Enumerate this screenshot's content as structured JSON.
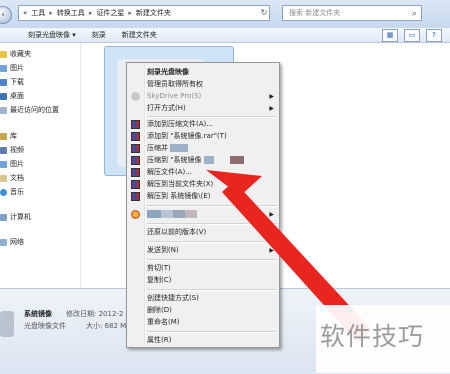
{
  "address_bar": {
    "back_icon": "back-arrow-icon",
    "forward_icon": "forward-arrow-icon",
    "path": [
      "«",
      "工具",
      "转换工具",
      "证件之星",
      "新建文件夹"
    ],
    "refresh_icon": "refresh-icon",
    "search_placeholder": "搜索 新建文件夹",
    "search_icon": "magnifier-icon"
  },
  "toolbar": {
    "items": [
      "刻录光盘映像 ▾",
      "刻录",
      "新建文件夹"
    ]
  },
  "sidebar": {
    "favorites_header": "收藏夹",
    "favorites": [
      "图片",
      "下载",
      "桌面",
      "最近访问的位置"
    ],
    "library_header": "库",
    "libraries": [
      "视频",
      "图片",
      "文档",
      "音乐"
    ],
    "computer": "计算机",
    "network": "网络"
  },
  "details": {
    "file_name": "系统镜像",
    "file_type": "光盘映像文件",
    "modified_label": "修改日期: 2012-2",
    "size_label": "大小: 682 MB"
  },
  "context_menu": {
    "items": [
      {
        "label": "刻录光盘映像",
        "bold": true
      },
      {
        "label": "管理员取得所有权"
      },
      {
        "label": "SkyDrive Pro(S)",
        "disabled": true,
        "submenu": true
      },
      {
        "label": "打开方式(H)",
        "submenu": true
      },
      {
        "label": "添加到压缩文件(A)...",
        "icon": "winrar-icon"
      },
      {
        "label": "添加到 \"系统镜像.rar\"(T)",
        "icon": "winrar-icon"
      },
      {
        "label": "压缩并",
        "icon": "winrar-icon"
      },
      {
        "label": "压缩到 \"系统镜像",
        "icon": "winrar-icon"
      },
      {
        "label": "解压文件(A)...",
        "icon": "winrar-icon"
      },
      {
        "label": "解压到当前文件夹(X)",
        "icon": "winrar-icon"
      },
      {
        "label": "解压到 系统镜像\\(E)",
        "icon": "winrar-icon"
      },
      {
        "label": "",
        "icon": "app-icon",
        "submenu": true
      },
      {
        "label": "还原以前的版本(V)"
      },
      {
        "label": "发送到(N)",
        "submenu": true
      },
      {
        "label": "剪切(T)"
      },
      {
        "label": "复制(C)"
      },
      {
        "label": "创建快捷方式(S)"
      },
      {
        "label": "删除(D)"
      },
      {
        "label": "重命名(M)"
      },
      {
        "label": "属性(R)"
      }
    ]
  },
  "watermark": "软件技巧",
  "colors": {
    "arrow": "#e8261f",
    "window_chrome": "#dbe7f5"
  }
}
